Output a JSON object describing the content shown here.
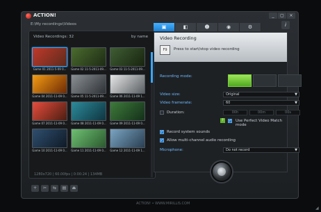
{
  "app": {
    "title": "ACTION!"
  },
  "window_buttons": [
    "_",
    "▢",
    "×"
  ],
  "path": "E:\\My recordings\\Videos",
  "library": {
    "header": "Video Recordings: 32",
    "sort": "by name",
    "status": "1280x720 | 60.00fps | 0:00:24 | 134MB"
  },
  "thumbnails": [
    {
      "caption": "Game 01 2011-5-09 0...",
      "colors": [
        "#c0392b",
        "#5a2b1c"
      ]
    },
    {
      "caption": "Game 02 11-5-2011-09...",
      "colors": [
        "#4b6b2f",
        "#1d2b14"
      ]
    },
    {
      "caption": "Game 03 11-5-2011-09...",
      "colors": [
        "#3f5d34",
        "#18240f"
      ]
    },
    {
      "caption": "Game 04 2011-11-09 0...",
      "colors": [
        "#f39c12",
        "#6e2a05"
      ]
    },
    {
      "caption": "Game 05 11-5-2011-09...",
      "colors": [
        "#8a8f93",
        "#2e3236"
      ]
    },
    {
      "caption": "Game 06 2011-11-09 1...",
      "colors": [
        "#e6e6e6",
        "#5a5f63"
      ]
    },
    {
      "caption": "Game 07 2011-11-09 0...",
      "colors": [
        "#e74c3c",
        "#4a1e12"
      ]
    },
    {
      "caption": "Game 08 2011-11-09 0...",
      "colors": [
        "#2c8a9a",
        "#0f3540"
      ]
    },
    {
      "caption": "Game 09 2011-11-09 0...",
      "colors": [
        "#3e7a3a",
        "#14301a"
      ]
    },
    {
      "caption": "Game 10 2011-11-09 0...",
      "colors": [
        "#2f4f6f",
        "#0f1a26"
      ]
    },
    {
      "caption": "Game 11 2011-11-09 0...",
      "colors": [
        "#6fbf73",
        "#2b5b2e"
      ]
    },
    {
      "caption": "Game 12 2011-11-09 1...",
      "colors": [
        "#7aa4c2",
        "#2a3f52"
      ]
    }
  ],
  "tools": [
    "+",
    "✂",
    "⇆",
    "▤",
    "⏏"
  ],
  "tabs": [
    {
      "name": "video-recording",
      "glyph": "▣"
    },
    {
      "name": "screenshot",
      "glyph": "◧"
    },
    {
      "name": "audio",
      "glyph": "☻"
    },
    {
      "name": "camera",
      "glyph": "◉"
    },
    {
      "name": "settings",
      "glyph": "⚙"
    }
  ],
  "help": "i",
  "video_recording": {
    "title": "Video Recording",
    "hint": "Press to start/stop video recording",
    "icon_text": "F9",
    "recording_mode_label": "Recording mode:",
    "video_size_label": "Video size:",
    "video_size_value": "Original",
    "video_framerate_label": "Video framerate:",
    "video_framerate_value": "60",
    "duration_label": "Duration:",
    "duration_values": [
      "00h",
      "00m",
      "00s"
    ],
    "perfect_match_label": "Use Perfect Video Match mode",
    "record_sounds_label": "Record system sounds",
    "multichannel_label": "Allow multi-channel audio recording",
    "microphone_label": "Microphone:",
    "microphone_value": "Do not record"
  },
  "footer": "ACTION! • WWW.MIRILLIS.COM"
}
